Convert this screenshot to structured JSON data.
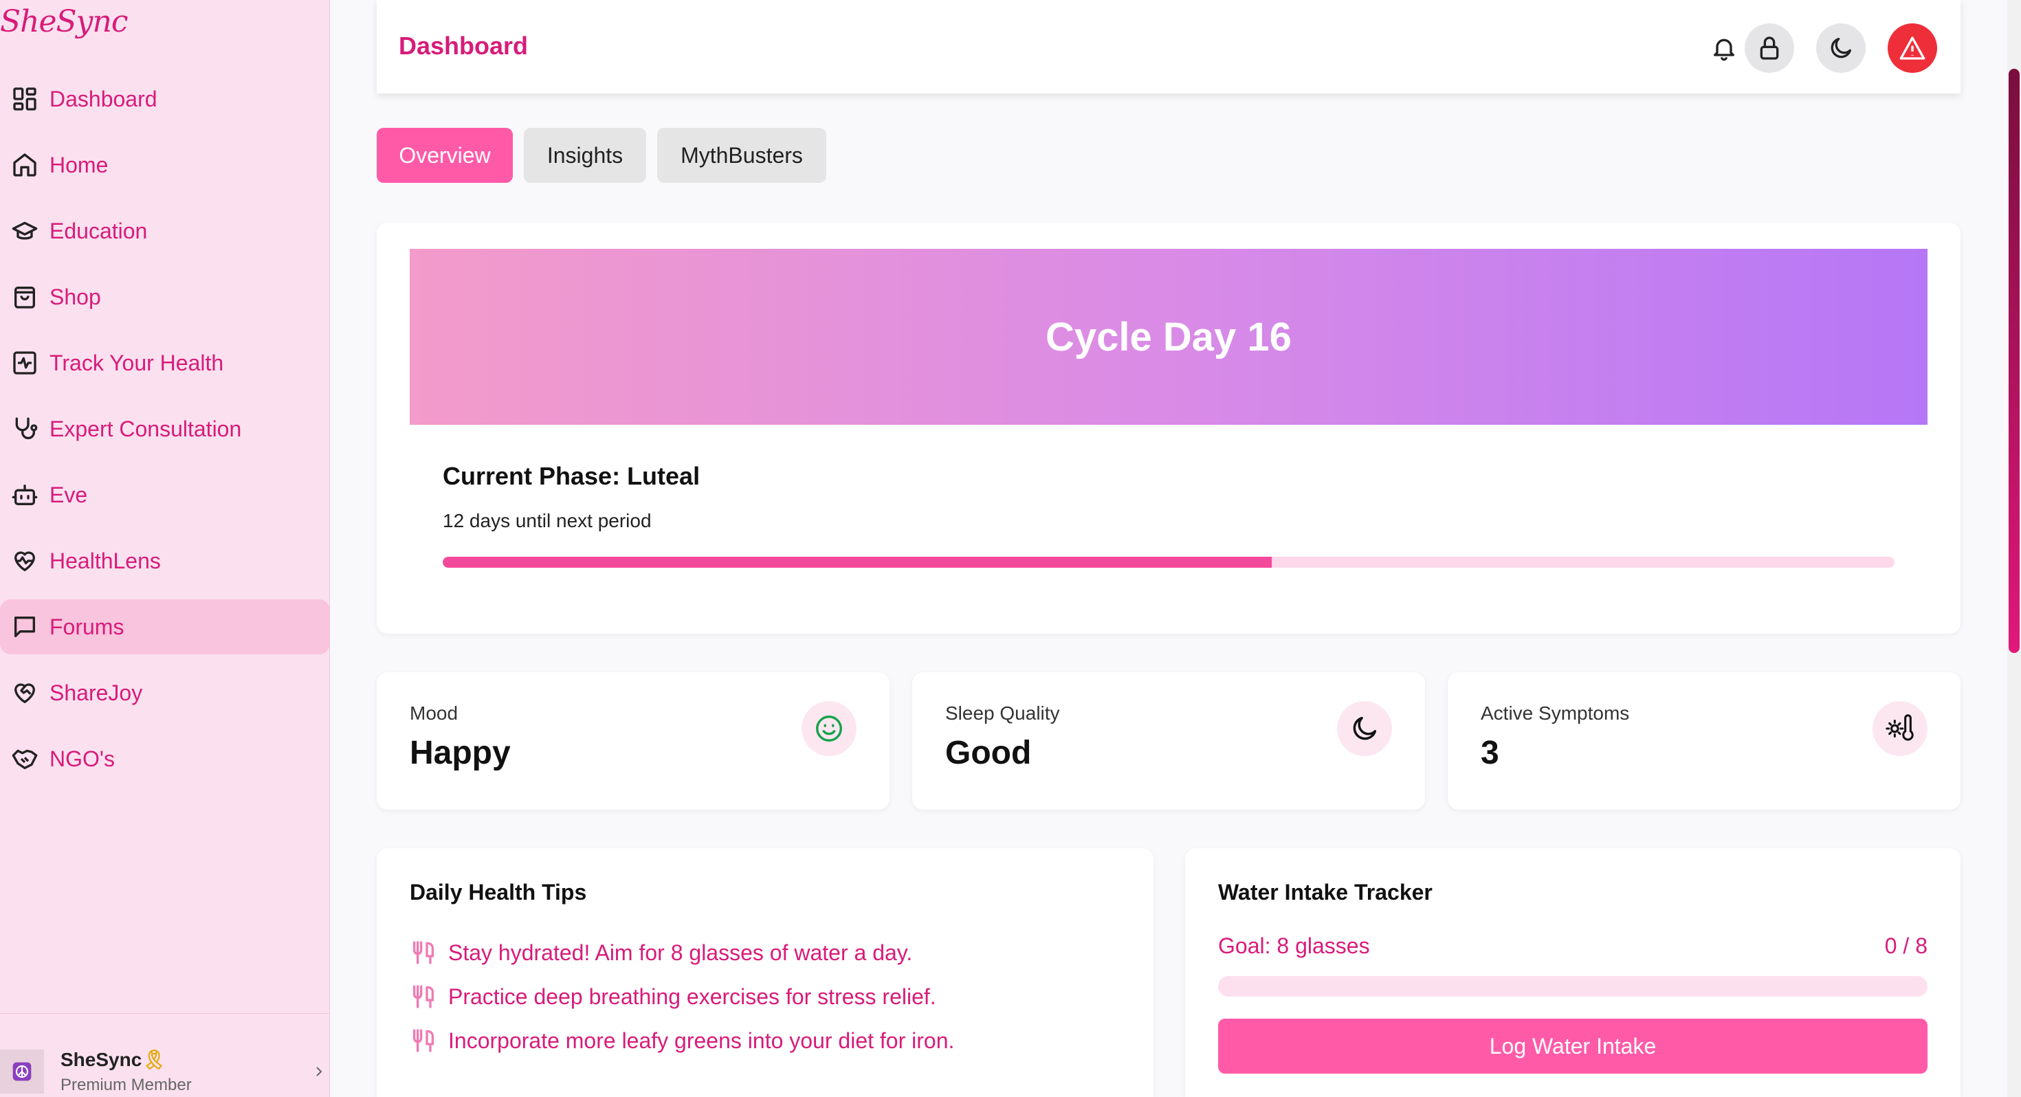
{
  "app": {
    "logo_text": "SheSync"
  },
  "sidebar": {
    "items": [
      {
        "label": "Dashboard",
        "icon": "dashboard-grid-icon"
      },
      {
        "label": "Home",
        "icon": "home-icon"
      },
      {
        "label": "Education",
        "icon": "graduation-cap-icon"
      },
      {
        "label": "Shop",
        "icon": "shopping-bag-icon"
      },
      {
        "label": "Track Your Health",
        "icon": "activity-icon"
      },
      {
        "label": "Expert Consultation",
        "icon": "stethoscope-icon"
      },
      {
        "label": "Eve",
        "icon": "bot-icon"
      },
      {
        "label": "HealthLens",
        "icon": "heart-pulse-icon"
      },
      {
        "label": "Forums",
        "icon": "message-square-icon",
        "active": true
      },
      {
        "label": "ShareJoy",
        "icon": "heart-handshake-icon"
      },
      {
        "label": "NGO's",
        "icon": "handshake-icon"
      }
    ],
    "user": {
      "name": "SheSync",
      "badge": "🎗",
      "role": "Premium Member"
    }
  },
  "header": {
    "title": "Dashboard",
    "icons": [
      "bell-icon",
      "lock-icon",
      "moon-icon",
      "alert-triangle-icon"
    ]
  },
  "tabs": [
    {
      "label": "Overview",
      "active": true
    },
    {
      "label": "Insights"
    },
    {
      "label": "MythBusters"
    }
  ],
  "cycle": {
    "title": "Cycle Day 16",
    "phase": "Current Phase: Luteal",
    "days_until": "12 days until next period",
    "progress_fraction": 0.571
  },
  "stats": [
    {
      "label": "Mood",
      "value": "Happy",
      "icon": "smile-icon",
      "icon_color": "#16a34a"
    },
    {
      "label": "Sleep Quality",
      "value": "Good",
      "icon": "moon-icon",
      "icon_color": "#111111"
    },
    {
      "label": "Active Symptoms",
      "value": "3",
      "icon": "thermometer-sun-icon",
      "icon_color": "#111111"
    }
  ],
  "tips": {
    "title": "Daily Health Tips",
    "items": [
      "Stay hydrated! Aim for 8 glasses of water a day.",
      "Practice deep breathing exercises for stress relief.",
      "Incorporate more leafy greens into your diet for iron."
    ],
    "icon": "utensils-icon"
  },
  "water": {
    "title": "Water Intake Tracker",
    "goal": "Goal: 8 glasses",
    "count": "0 / 8",
    "progress_fraction": 0,
    "button": "Log Water Intake"
  },
  "colors": {
    "brand": "#d81b7a",
    "accent": "#ff5aa8",
    "sidebar_bg": "#fbe1ef",
    "alert": "#ee2f3a"
  }
}
